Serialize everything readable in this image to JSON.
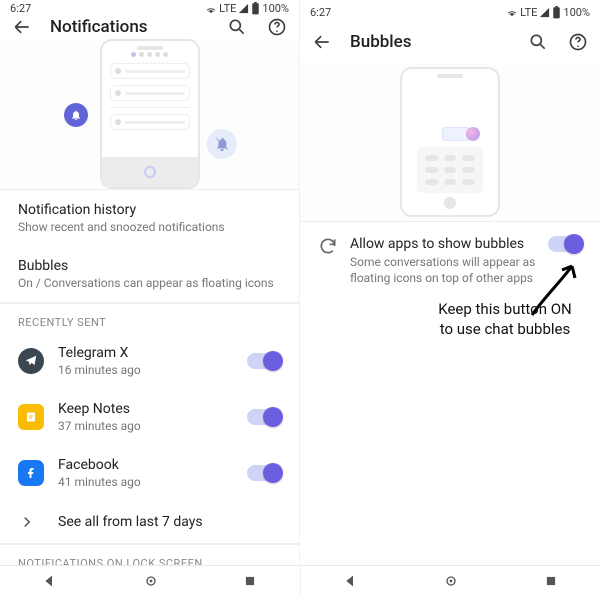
{
  "status": {
    "time": "6:27",
    "network_label": "LTE",
    "battery_label": "100%"
  },
  "left": {
    "title": "Notifications",
    "history": {
      "label": "Notification history",
      "sub": "Show recent and snoozed notifications"
    },
    "bubbles": {
      "label": "Bubbles",
      "sub": "On / Conversations can appear as floating icons"
    },
    "recently_header": "Recently sent",
    "apps": [
      {
        "name": "Telegram X",
        "sub": "16 minutes ago"
      },
      {
        "name": "Keep Notes",
        "sub": "37 minutes ago"
      },
      {
        "name": "Facebook",
        "sub": "41 minutes ago"
      }
    ],
    "see_all": "See all from last 7 days",
    "lockscreen_header": "Notifications on lock screen"
  },
  "right": {
    "title": "Bubbles",
    "allow": {
      "label": "Allow apps to show bubbles",
      "sub": "Some conversations will appear as floating icons on top of other apps"
    }
  },
  "annotation": {
    "line1": "Keep this button ON",
    "line2": "to use chat bubbles"
  }
}
